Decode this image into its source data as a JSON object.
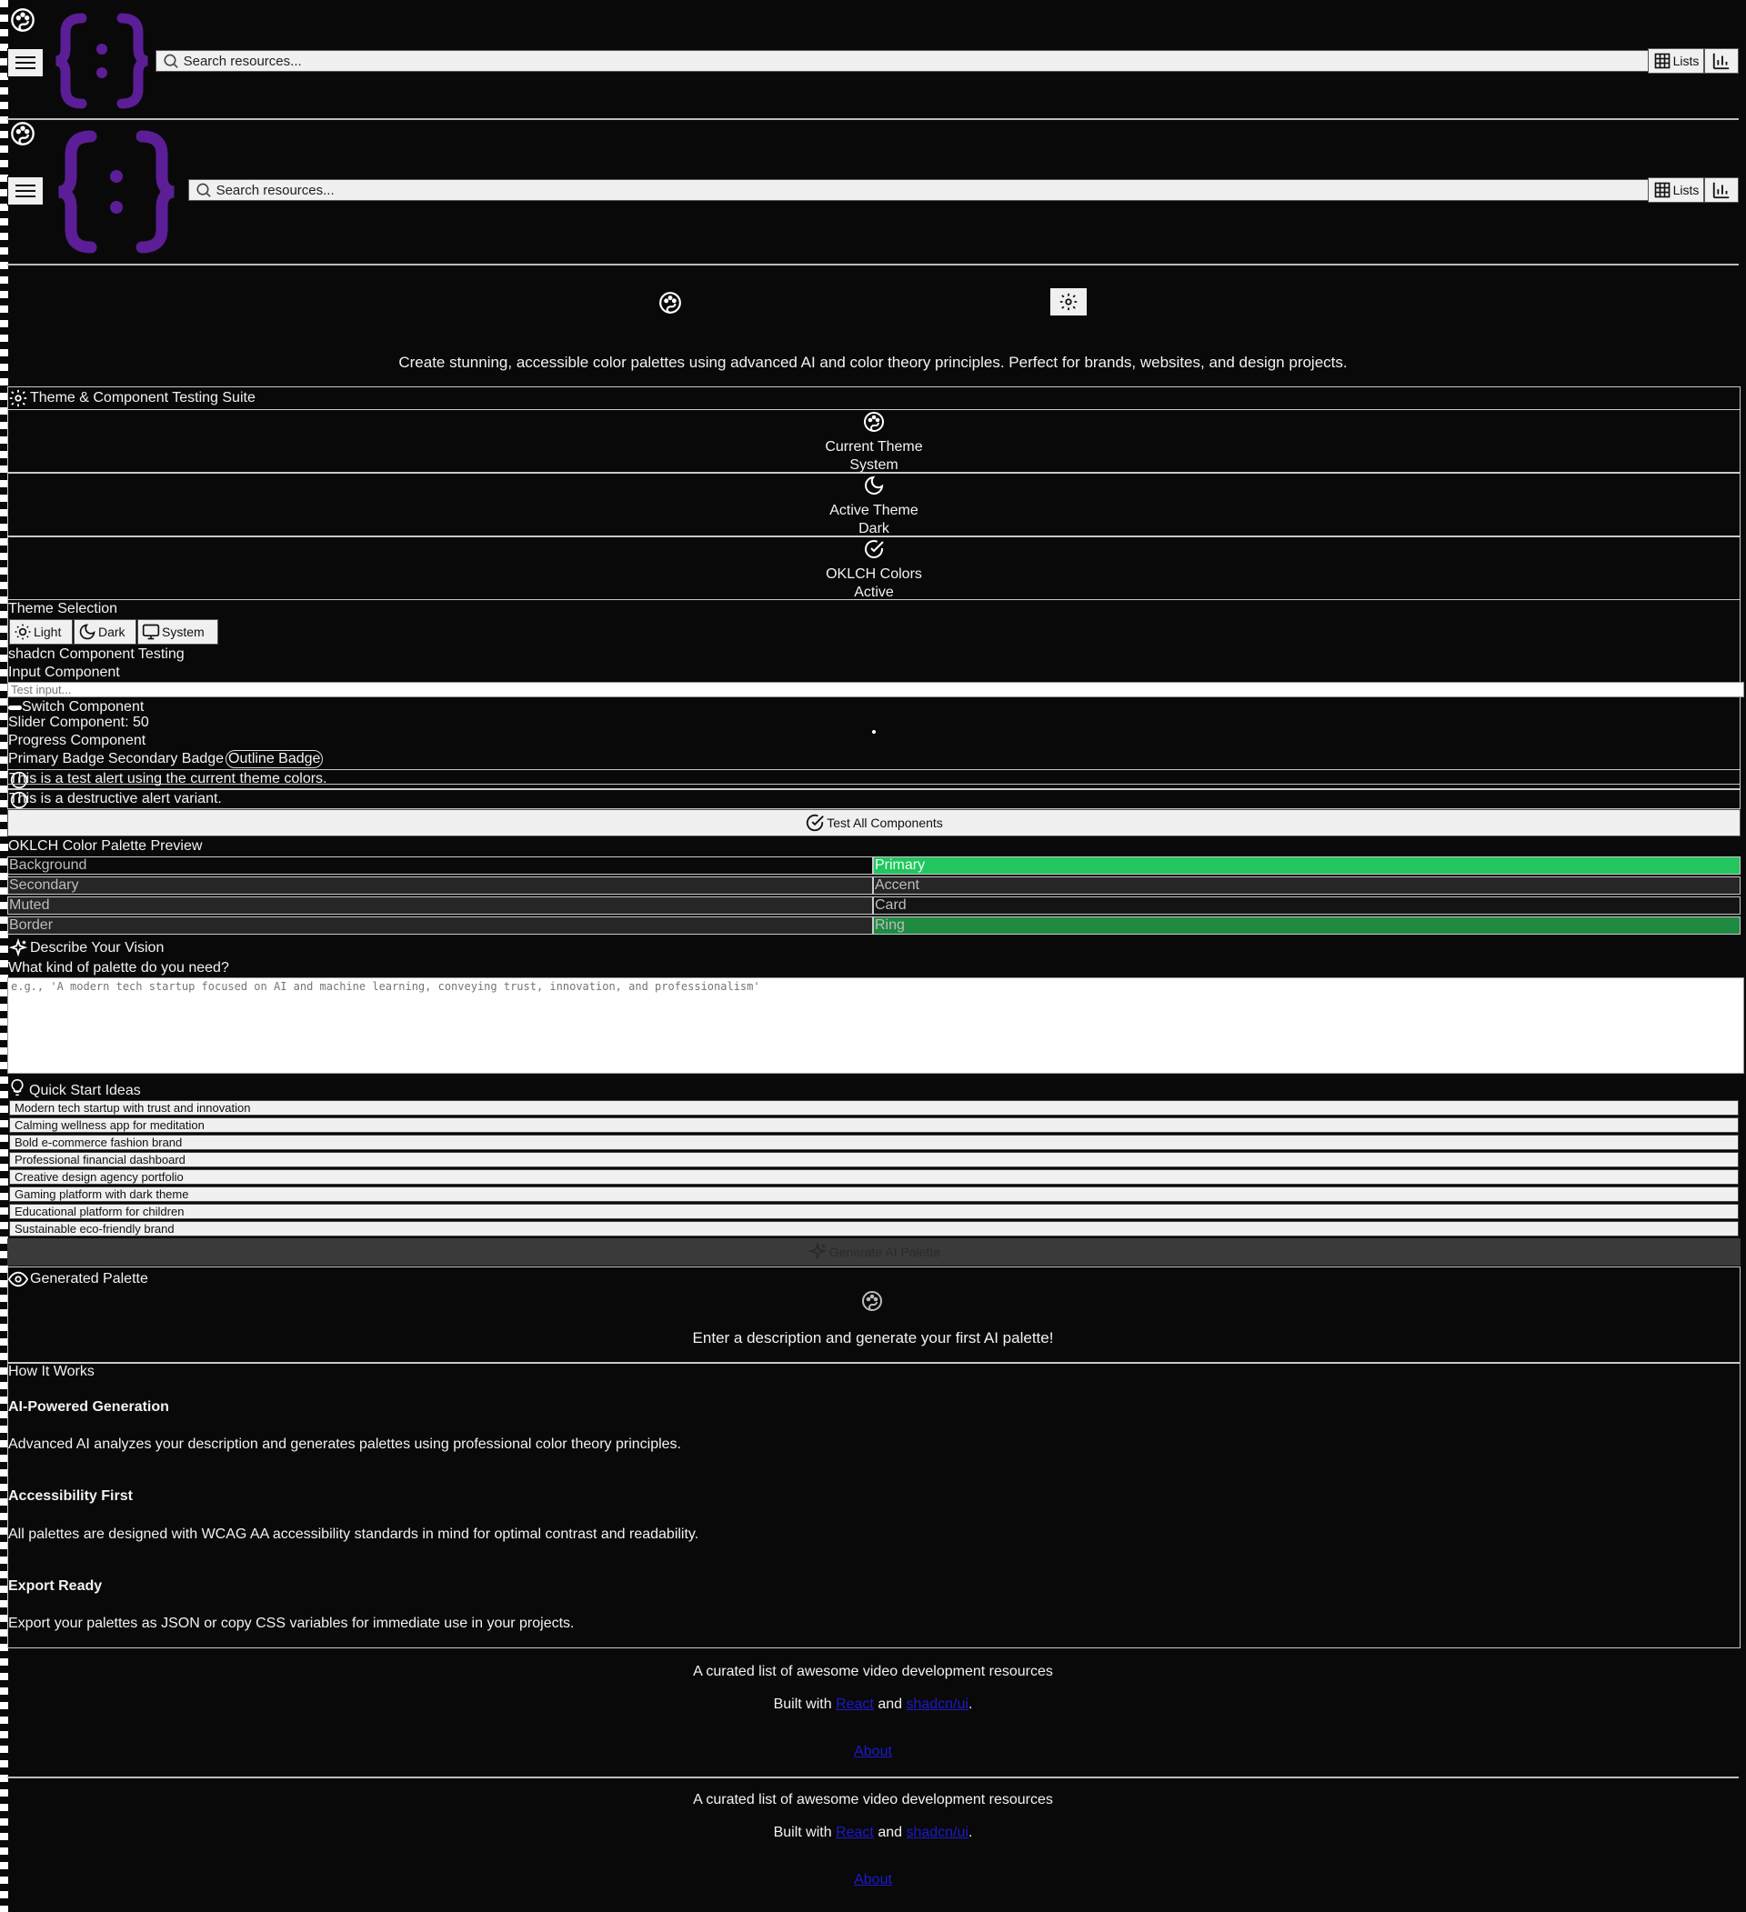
{
  "header": {
    "search_placeholder": "Search resources...",
    "lists_label": "Lists"
  },
  "colors": {
    "logo_purple": "#5b1e96",
    "primary_green": "#22c55e",
    "ring_green": "#1f8a42",
    "background": "#0a0909"
  },
  "hero": {
    "description": "Create stunning, accessible color palettes using advanced AI and color theory principles. Perfect for brands, websites, and design projects."
  },
  "testing": {
    "title": "Theme & Component Testing Suite",
    "stats": [
      {
        "label": "Current Theme",
        "value": "System",
        "icon": "palette-icon"
      },
      {
        "label": "Active Theme",
        "value": "Dark",
        "icon": "moon-icon"
      },
      {
        "label": "OKLCH Colors",
        "value": "Active",
        "icon": "check-circle-icon"
      }
    ],
    "theme_selection_label": "Theme Selection",
    "theme_buttons": [
      "Light",
      "Dark",
      "System"
    ],
    "component_testing_label": "shadcn Component Testing",
    "input_component_label": "Input Component",
    "input_placeholder": "Test input...",
    "switch_label": "Switch Component",
    "slider_label": "Slider Component: 50",
    "slider_value": 50,
    "progress_label": "Progress Component",
    "badges": [
      "Primary Badge",
      "Secondary Badge",
      "Outline Badge"
    ],
    "alert_default": "This is a test alert using the current theme colors.",
    "alert_destructive": "This is a destructive alert variant.",
    "test_all_label": "Test All Components"
  },
  "oklch": {
    "title": "OKLCH Color Palette Preview",
    "swatches_left": [
      "Background",
      "Secondary",
      "Muted",
      "Border"
    ],
    "swatches_right": [
      "Primary",
      "Accent",
      "Card",
      "Ring"
    ]
  },
  "vision": {
    "title": "Describe Your Vision",
    "question": "What kind of palette do you need?",
    "textarea_placeholder": "e.g., 'A modern tech startup focused on AI and machine learning, conveying trust, innovation, and professionalism'",
    "quick_start_title": "Quick Start Ideas",
    "ideas": [
      "Modern tech startup with trust and innovation",
      "Calming wellness app for meditation",
      "Bold e-commerce fashion brand",
      "Professional financial dashboard",
      "Creative design agency portfolio",
      "Gaming platform with dark theme",
      "Educational platform for children",
      "Sustainable eco-friendly brand"
    ],
    "generate_label": "Generate AI Palette"
  },
  "generated": {
    "title": "Generated Palette",
    "empty_text": "Enter a description and generate your first AI palette!"
  },
  "how": {
    "title": "How It Works",
    "items": [
      {
        "heading": "AI-Powered Generation",
        "text": "Advanced AI analyzes your description and generates palettes using professional color theory principles."
      },
      {
        "heading": "Accessibility First",
        "text": "All palettes are designed with WCAG AA accessibility standards in mind for optimal contrast and readability."
      },
      {
        "heading": "Export Ready",
        "text": "Export your palettes as JSON or copy CSS variables for immediate use in your projects."
      }
    ]
  },
  "footer": {
    "tagline": "A curated list of awesome video development resources",
    "built_with": "Built with",
    "react": "React",
    "and": "and",
    "shadcn": "shadcn/ui",
    "period": ".",
    "about": "About"
  }
}
